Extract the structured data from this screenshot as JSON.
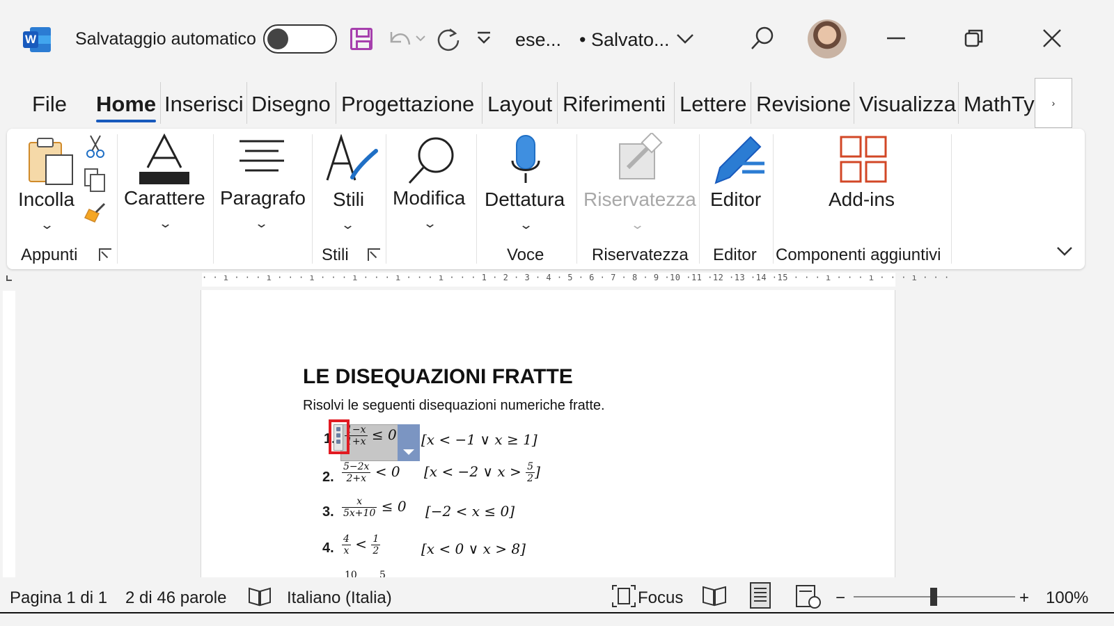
{
  "titlebar": {
    "autosave_label": "Salvataggio automatico",
    "doc_name": "ese...",
    "saved_status": "• Salvato...",
    "icons": [
      "word-logo-icon",
      "save-icon",
      "undo-icon",
      "redo-icon",
      "customize-icon",
      "search-icon",
      "minimize-icon",
      "restore-icon",
      "close-icon"
    ]
  },
  "tabs": {
    "file": "File",
    "home": "Home",
    "insert": "Inserisci",
    "draw": "Disegno",
    "design": "Progettazione",
    "layout": "Layout",
    "references": "Riferimenti",
    "mailings": "Lettere",
    "review": "Revisione",
    "view": "Visualizza",
    "mathtype": "MathTy",
    "more": "›"
  },
  "ribbon": {
    "paste": "Incolla",
    "font": "Carattere",
    "paragraph": "Paragrafo",
    "styles": "Stili",
    "editing": "Modifica",
    "dictate": "Dettatura",
    "sensitivity": "Riservatezza",
    "editor": "Editor",
    "addins": "Add-ins",
    "groups": {
      "clipboard": "Appunti",
      "styles": "Stili",
      "voice": "Voce",
      "sensitivity": "Riservatezza",
      "editor": "Editor",
      "addins": "Componenti aggiuntivi"
    }
  },
  "ruler": {
    "h_ticks": "· · ı · · · ı · · · ı · · · ı · · · ı · · · ı · · · 1 · 2 · 3 · 4 · 5 · 6 · 7 · 8 · 9 ·10 ·11 ·12 ·13 ·14 ·15 · · · ı · · · ı · · · ı · · ·"
  },
  "document": {
    "title": "LE DISEQUAZIONI FRATTE",
    "instruction": "Risolvi le seguenti disequazioni numeriche fratte.",
    "exercises": [
      {
        "num": "1.",
        "frac_num": "1−x",
        "frac_den": "1+x",
        "rel": "≤ 0",
        "answer": "[x < −1 ∨ x ≥ 1]"
      },
      {
        "num": "2.",
        "frac_num": "5−2x",
        "frac_den": "2+x",
        "rel": "< 0",
        "answer_pre": "[x < −2 ∨ x >",
        "answer_frac_num": "5",
        "answer_frac_den": "2",
        "answer_post": "]"
      },
      {
        "num": "3.",
        "frac_num": "x",
        "frac_den": "5x+10",
        "rel": "≤ 0",
        "answer": "[−2 < x ≤ 0]"
      },
      {
        "num": "4.",
        "frac_num": "4",
        "frac_den": "x",
        "rel": "<",
        "rhs_num": "1",
        "rhs_den": "2",
        "answer": "[x < 0 ∨ x > 8]"
      },
      {
        "num": "",
        "frac_num": "10",
        "rhs_num": "5"
      }
    ]
  },
  "statusbar": {
    "page": "Pagina 1 di 1",
    "words": "2 di 46 parole",
    "language": "Italiano (Italia)",
    "focus": "Focus",
    "zoom_minus": "−",
    "zoom_plus": "+",
    "zoom": "100%",
    "zoom_level": 0.5
  },
  "colors": {
    "accent": "#185abd",
    "save_icon": "#a63fad",
    "addins_icon": "#d24726",
    "highlight": "#e11b22"
  }
}
